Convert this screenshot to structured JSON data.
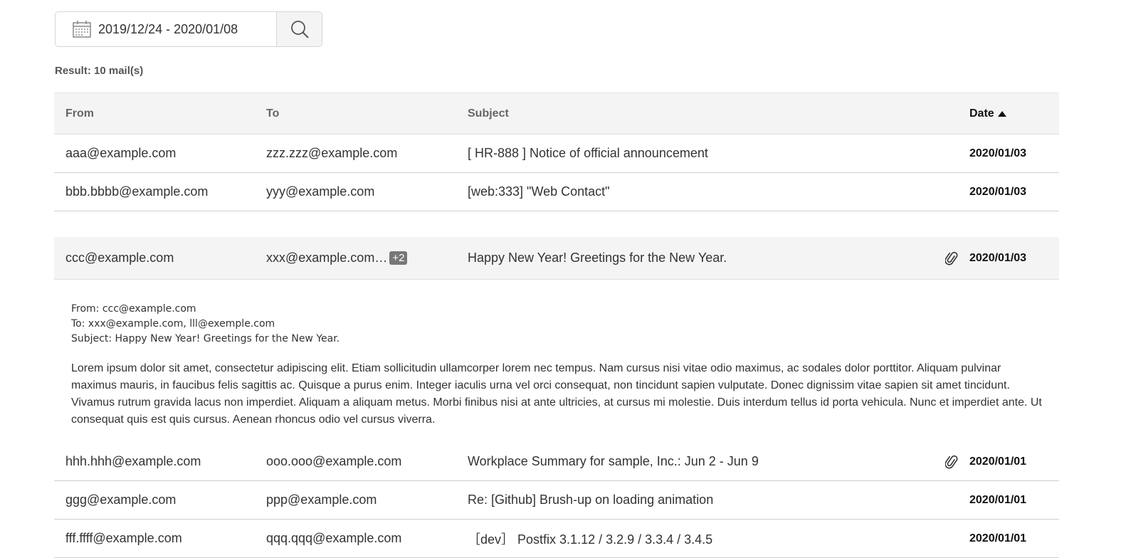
{
  "search": {
    "date_range": "2019/12/24 - 2020/01/08"
  },
  "result_text": "Result: 10 mail(s)",
  "columns": {
    "from": "From",
    "to": "To",
    "subject": "Subject",
    "date": "Date"
  },
  "rows_top": [
    {
      "from": "aaa@example.com",
      "to": "zzz.zzz@example.com",
      "subject": "[ HR-888 ] Notice of official announcement",
      "date": "2020/01/03",
      "attachment": false
    },
    {
      "from": "bbb.bbbb@example.com",
      "to": "yyy@example.com",
      "subject": "[web:333] \"Web Contact\"",
      "date": "2020/01/03",
      "attachment": false
    }
  ],
  "expanded": {
    "from": "ccc@example.com",
    "to": "xxx@example.com…",
    "extra_count": "+2",
    "subject": "Happy New Year! Greetings for the New Year.",
    "date": "2020/01/03",
    "attachment": true,
    "detail": {
      "from_line": "From: ccc@example.com",
      "to_line": "To: xxx@example.com, lll@exemple.com",
      "subject_line": "Subject: Happy New Year! Greetings for the New Year.",
      "body": "Lorem ipsum dolor sit amet, consectetur adipiscing elit. Etiam sollicitudin ullamcorper lorem nec tempus. Nam cursus nisi vitae odio maximus, ac sodales dolor porttitor. Aliquam pulvinar maximus mauris, in faucibus felis sagittis ac. Quisque a purus enim. Integer iaculis urna vel orci consequat, non tincidunt sapien vulputate. Donec dignissim vitae sapien sit amet tincidunt. Vivamus rutrum gravida lacus non imperdiet. Aliquam a aliquam metus. Morbi finibus nisi at ante ultricies, at cursus mi molestie. Duis interdum tellus id porta vehicula. Nunc et imperdiet ante. Ut consequat quis est quis cursus. Aenean rhoncus odio vel cursus viverra."
    }
  },
  "rows_bottom": [
    {
      "from": "hhh.hhh@example.com",
      "to": "ooo.ooo@example.com",
      "subject": "Workplace Summary for sample, Inc.: Jun 2 - Jun 9",
      "date": "2020/01/01",
      "attachment": true
    },
    {
      "from": "ggg@example.com",
      "to": "ppp@example.com",
      "subject": "Re: [Github] Brush-up on loading animation",
      "date": "2020/01/01",
      "attachment": false
    },
    {
      "from": "fff.ffff@example.com",
      "to": "qqq.qqq@example.com",
      "subject": "［dev］ Postfix 3.1.12 / 3.2.9 / 3.3.4 / 3.4.5",
      "date": "2020/01/01",
      "attachment": false
    }
  ],
  "icons": {
    "calendar": "calendar-icon",
    "search": "search-icon",
    "attachment": "paperclip-icon",
    "sort": "sort-ascending-icon"
  }
}
